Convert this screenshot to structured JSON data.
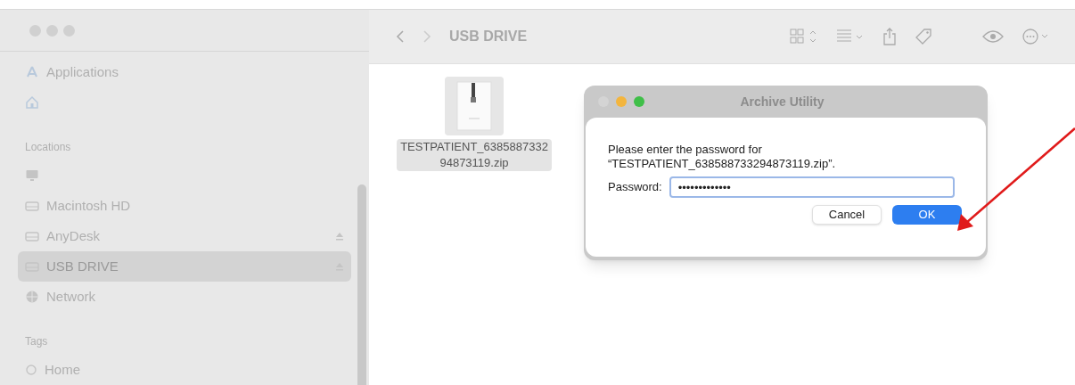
{
  "sidebar": {
    "items": [
      {
        "kind": "app",
        "label": "Applications",
        "selected": false
      },
      {
        "kind": "home",
        "selected": false
      },
      {
        "kind": "header",
        "label": "Locations"
      },
      {
        "kind": "computer",
        "selected": false
      },
      {
        "kind": "disk",
        "label": "Macintosh HD",
        "selected": false,
        "eject": false
      },
      {
        "kind": "disk",
        "label": "AnyDesk",
        "selected": false,
        "eject": true
      },
      {
        "kind": "disk",
        "label": "USB DRIVE",
        "selected": true,
        "eject": true
      },
      {
        "kind": "network",
        "label": "Network",
        "selected": false
      },
      {
        "kind": "header",
        "label": "Tags"
      },
      {
        "kind": "tag",
        "label": "Home",
        "selected": false
      }
    ]
  },
  "toolbar": {
    "title": "USB DRIVE"
  },
  "files": [
    {
      "name_lines": [
        "TESTPATIENT_6385887332",
        "94873119.zip"
      ],
      "selected": true
    }
  ],
  "dialog": {
    "title": "Archive Utility",
    "message_lines": [
      "Please enter the password for",
      "“TESTPATIENT_638588733294873119.zip”."
    ],
    "password_label": "Password:",
    "password_value": "•••••••••••••",
    "buttons": [
      {
        "label": "Cancel",
        "kind": "secondary"
      },
      {
        "label": "OK",
        "kind": "primary"
      }
    ]
  }
}
